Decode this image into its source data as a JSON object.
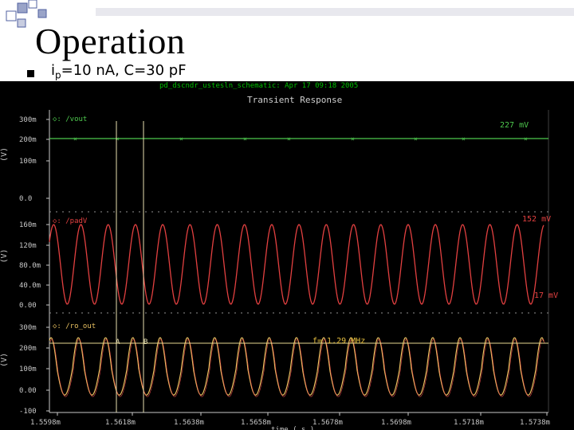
{
  "slide": {
    "title": "Operation",
    "bullet_text": "i",
    "bullet_subscript": "p",
    "bullet_rest": "=10 nA, C=30 pF"
  },
  "scope": {
    "header": "pd_dscndr_ustesln_schematic: Apr 17 09:18 2005",
    "plot_title": "Transient Response",
    "panels": [
      {
        "signal": "/vout",
        "value_label": "227 mV",
        "y_ticks": [
          "300m",
          "200m",
          "100m",
          "0.0"
        ],
        "unit": "(V)",
        "color": "#4ec94e"
      },
      {
        "signal": "/padV",
        "value_label": "152 mV",
        "value_label_low": "17 mV",
        "y_ticks": [
          "160m",
          "120m",
          "80.0m",
          "40.0m",
          "0.00"
        ],
        "unit": "(V)",
        "color": "#e24040"
      },
      {
        "signal": "/ro_out",
        "annotation": "f= 1.29 MHz",
        "cursor_a": "A",
        "cursor_b": "B",
        "y_ticks": [
          "300m",
          "200m",
          "100m",
          "0.00",
          "-100"
        ],
        "unit": "(V)",
        "color": "#e8c060"
      }
    ],
    "x_ticks": [
      "1.5598m",
      "1.5618m",
      "1.5638m",
      "1.5658m",
      "1.5678m",
      "1.5698m",
      "1.5718m",
      "1.5738m"
    ],
    "x_axis_label": "time ( s )"
  }
}
